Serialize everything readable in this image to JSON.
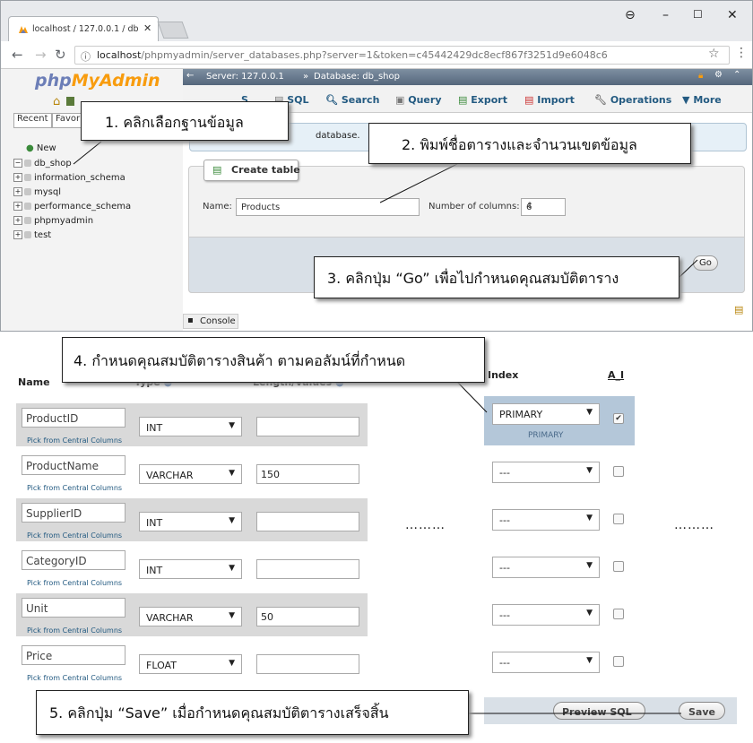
{
  "browser": {
    "tab_title": "localhost / 127.0.0.1 / db",
    "url_host": "localhost",
    "url_path": "/phpmyadmin/server_databases.php?server=1&token=c45442429dc8ecf867f3251d9e6048c6"
  },
  "pma": {
    "logo_php": "php",
    "logo_my": "MyAdmin",
    "recent": "Recent",
    "favorites": "Favorit",
    "tree": [
      "New",
      "db_shop",
      "information_schema",
      "mysql",
      "performance_schema",
      "phpmyadmin",
      "test"
    ],
    "breadcrumb_server": "Server: 127.0.0.1",
    "breadcrumb_db": "Database: db_shop",
    "tabs": [
      "Structure",
      "SQL",
      "Search",
      "Query",
      "Export",
      "Import",
      "Operations",
      "More"
    ],
    "tab_partial": "S",
    "info_text": "database.",
    "create_table_label": "Create table",
    "name_label": "Name:",
    "name_value": "Products",
    "columns_label": "Number of columns:",
    "columns_value": "6",
    "go_label": "Go",
    "console_label": "Console"
  },
  "callouts": {
    "c1": "1. คลิกเลือกฐานข้อมูล",
    "c2": "2. พิมพ์ชื่อตารางและจำนวนเขตข้อมูล",
    "c3": "3. คลิกปุ่ม “Go”  เพื่อไปกำหนดคุณสมบัติตาราง",
    "c4": "4. กำหนดคุณสมบัติตารางสินค้า  ตามคอลัมน์ที่กำหนด",
    "c5": "5. คลิกปุ่ม “Save”   เมื่อกำหนดคุณสมบัติตารางเสร็จสิ้น"
  },
  "structure": {
    "headers": {
      "name": "Name",
      "type": "Type",
      "length": "Length/Values",
      "index": "Index",
      "ai": "A_I"
    },
    "pick_label": "Pick from Central Columns",
    "rows": [
      {
        "name": "ProductID",
        "type": "INT",
        "length": "",
        "index": "PRIMARY",
        "index_sub": "PRIMARY",
        "ai": true
      },
      {
        "name": "ProductName",
        "type": "VARCHAR",
        "length": "150",
        "index": "---",
        "ai": false
      },
      {
        "name": "SupplierID",
        "type": "INT",
        "length": "",
        "index": "---",
        "ai": false
      },
      {
        "name": "CategoryID",
        "type": "INT",
        "length": "",
        "index": "---",
        "ai": false
      },
      {
        "name": "Unit",
        "type": "VARCHAR",
        "length": "50",
        "index": "---",
        "ai": false
      },
      {
        "name": "Price",
        "type": "FLOAT",
        "length": "",
        "index": "---",
        "ai": false
      }
    ],
    "ellipsis": "………",
    "preview_sql": "Preview SQL",
    "save": "Save"
  }
}
